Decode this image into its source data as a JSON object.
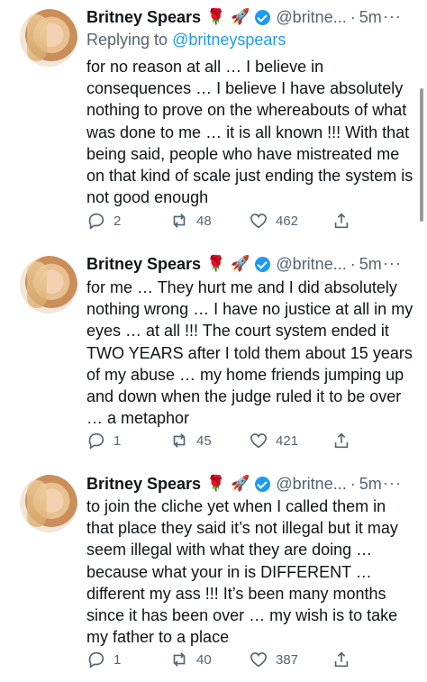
{
  "tweets": [
    {
      "name": "Britney Spears",
      "emoji1": "🌹",
      "emoji2": "🚀",
      "handle": "@britne...",
      "dot": "·",
      "time": "5m",
      "more": "···",
      "reply_prefix": "Replying to",
      "reply_handle": "@britneyspears",
      "text": "for no reason at all … I believe in consequences … I believe I have absolutely nothing to prove on the whereabouts of what was done to me … it is all known !!! With that being said, people who have mistreated me on that kind of scale just ending the system is not good enough",
      "replies": "2",
      "retweets": "48",
      "likes": "462"
    },
    {
      "name": "Britney Spears",
      "emoji1": "🌹",
      "emoji2": "🚀",
      "handle": "@britne...",
      "dot": "·",
      "time": "5m",
      "more": "···",
      "text": "for me … They hurt me and I did absolutely nothing wrong … I have no justice at all in my eyes … at all !!! The court system ended it TWO YEARS after I told them about 15 years of my abuse … my home friends jumping up and down when the judge ruled it to be over … a metaphor",
      "replies": "1",
      "retweets": "45",
      "likes": "421"
    },
    {
      "name": "Britney Spears",
      "emoji1": "🌹",
      "emoji2": "🚀",
      "handle": "@britne...",
      "dot": "·",
      "time": "5m",
      "more": "···",
      "text": "to join the cliche yet when I called them in that place they said it’s not illegal but it may seem illegal with what they are doing … because what your in is DIFFERENT … different my ass !!! It’s been many months since it has been over … my wish is to take my father to a place",
      "replies": "1",
      "retweets": "40",
      "likes": "387"
    }
  ],
  "colors": {
    "accent": "#1d9bf0",
    "secondary_text": "#536471",
    "primary_text": "#0f1419",
    "rose": "#d21f3c"
  }
}
